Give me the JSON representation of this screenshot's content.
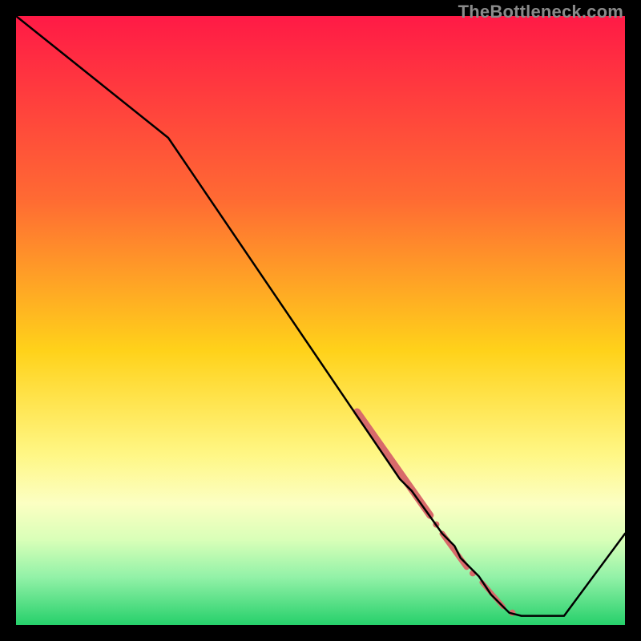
{
  "watermark": "TheBottleneck.com",
  "chart_data": {
    "type": "line",
    "title": "",
    "xlabel": "",
    "ylabel": "",
    "xlim": [
      0,
      100
    ],
    "ylim": [
      0,
      100
    ],
    "line": {
      "x": [
        0,
        25,
        63,
        64,
        65,
        70,
        72,
        73,
        76,
        78,
        80,
        81,
        83,
        90,
        100
      ],
      "y": [
        100,
        80,
        24,
        23,
        22,
        15,
        13,
        11,
        8,
        5,
        3,
        2,
        1.5,
        1.5,
        15
      ]
    },
    "highlight_segments": [
      {
        "x": [
          56,
          68
        ],
        "y": [
          35,
          18
        ],
        "width": 9,
        "color": "#d86a6a"
      },
      {
        "x": [
          70,
          74
        ],
        "y": [
          15,
          9.5
        ],
        "width": 7,
        "color": "#d86a6a"
      },
      {
        "x": [
          76.5,
          80
        ],
        "y": [
          7,
          3
        ],
        "width": 6,
        "color": "#d86a6a"
      }
    ],
    "highlight_dots": [
      {
        "x": 69,
        "y": 16.5,
        "r": 4,
        "color": "#d86a6a"
      },
      {
        "x": 75,
        "y": 8.5,
        "r": 4,
        "color": "#d86a6a"
      },
      {
        "x": 81.5,
        "y": 2,
        "r": 4,
        "color": "#d86a6a"
      }
    ],
    "gradient_stops": [
      {
        "offset": 0,
        "color": "#ff1a46"
      },
      {
        "offset": 0.3,
        "color": "#ff6a33"
      },
      {
        "offset": 0.55,
        "color": "#ffd21a"
      },
      {
        "offset": 0.72,
        "color": "#fff785"
      },
      {
        "offset": 0.8,
        "color": "#fcffc2"
      },
      {
        "offset": 0.86,
        "color": "#d9ffb8"
      },
      {
        "offset": 0.92,
        "color": "#94f2a8"
      },
      {
        "offset": 1.0,
        "color": "#26d06b"
      }
    ]
  }
}
